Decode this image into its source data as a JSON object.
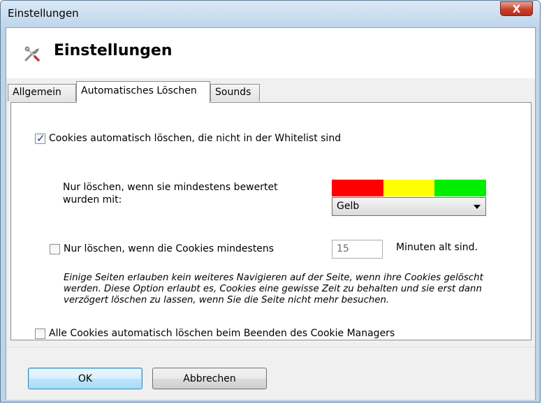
{
  "window": {
    "title": "Einstellungen",
    "close_label": "X"
  },
  "header": {
    "title": "Einstellungen",
    "icon": "tools-icon"
  },
  "tabs": [
    {
      "label": "Allgemein",
      "active": false
    },
    {
      "label": "Automatisches Löschen",
      "active": true
    },
    {
      "label": "Sounds",
      "active": false
    }
  ],
  "panel": {
    "auto_delete": {
      "checked": true,
      "label": "Cookies automatisch löschen, die nicht in der Whitelist sind"
    },
    "rating": {
      "label_line1": "Nur löschen, wenn sie mindestens bewertet",
      "label_line2": "wurden mit:",
      "colors": [
        "#ff0000",
        "#ffff00",
        "#00ee00"
      ],
      "selected": "Gelb"
    },
    "min_age": {
      "checked": false,
      "label": "Nur löschen, wenn die Cookies mindestens",
      "value": "15",
      "suffix": "Minuten alt sind."
    },
    "note": "Einige Seiten erlauben kein weiteres Navigieren auf der Seite, wenn ihre Cookies gelöscht werden. Diese Option erlaubt es, Cookies eine gewisse Zeit zu behalten und sie erst dann verzögert löschen zu lassen, wenn Sie die Seite nicht mehr besuchen.",
    "on_exit": {
      "checked": false,
      "label": "Alle Cookies automatisch löschen beim Beenden des Cookie Managers"
    }
  },
  "buttons": {
    "ok": "OK",
    "cancel": "Abbrechen"
  }
}
